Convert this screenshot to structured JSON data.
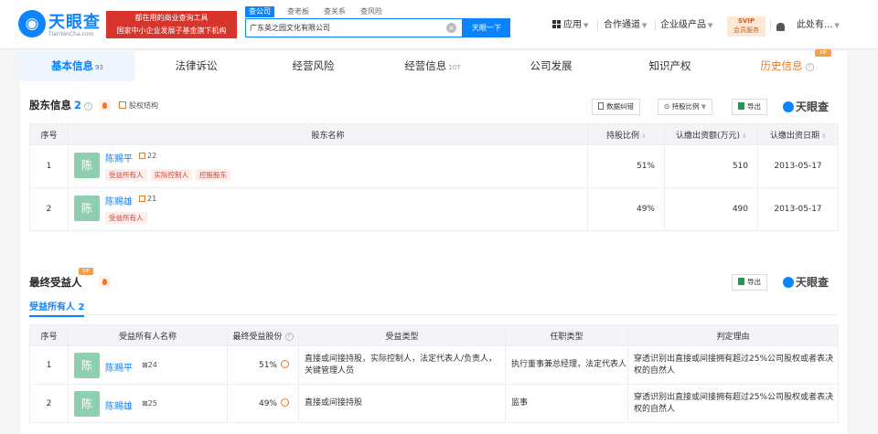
{
  "header": {
    "logo_name": "天眼查",
    "logo_sub": "TianYanCha.com",
    "banner_line1": "都在用的商业查询工具",
    "banner_line2": "国家中小企业发展子基金旗下机构",
    "search_tabs": [
      "查公司",
      "查老板",
      "查关系",
      "查风险"
    ],
    "search_value": "广东英之园文化有限公司",
    "search_button": "天眼一下",
    "nav": {
      "apps": "应用",
      "channel": "合作通道",
      "enterprise": "企业级产品",
      "user": "此处有..."
    },
    "vip": {
      "top": "SVIP",
      "bottom": "会员服务"
    }
  },
  "tabs": [
    {
      "label": "基本信息",
      "count": "93"
    },
    {
      "label": "法律诉讼",
      "count": ""
    },
    {
      "label": "经营风险",
      "count": ""
    },
    {
      "label": "经营信息",
      "count": "107"
    },
    {
      "label": "公司发展",
      "count": ""
    },
    {
      "label": "知识产权",
      "count": ""
    },
    {
      "label": "历史信息",
      "count": ""
    }
  ],
  "vip_tag": "VIP",
  "shareholders": {
    "title": "股东信息",
    "count": "2",
    "equity_link": "股权结构",
    "btn_correct": "数据纠错",
    "btn_ratio": "持股比例",
    "btn_export": "导出",
    "brand": "天眼查",
    "headers": [
      "序号",
      "股东名称",
      "持股比例",
      "认缴出资额(万元)",
      "认缴出资日期"
    ],
    "rows": [
      {
        "no": "1",
        "avatar": "陈",
        "name": "陈赐平",
        "num": "22",
        "tags": [
          "受益所有人",
          "实际控制人",
          "控股股东"
        ],
        "ratio": "51%",
        "amount": "510",
        "date": "2013-05-17"
      },
      {
        "no": "2",
        "avatar": "陈",
        "name": "陈赐雄",
        "num": "21",
        "tags": [
          "受益所有人"
        ],
        "ratio": "49%",
        "amount": "490",
        "date": "2013-05-17"
      }
    ]
  },
  "beneficiaries": {
    "title": "最终受益人",
    "btn_export": "导出",
    "brand": "天眼查",
    "subtab": "受益所有人",
    "subtab_count": "2",
    "headers": [
      "序号",
      "受益所有人名称",
      "最终受益股份",
      "受益类型",
      "任职类型",
      "判定理由"
    ],
    "rows": [
      {
        "no": "1",
        "avatar": "陈",
        "name": "陈赐平",
        "num": "24",
        "share": "51%",
        "type": "直接或间接持股，实际控制人，法定代表人/负责人，关键管理人员",
        "position": "执行董事兼总经理，法定代表人",
        "reason": "穿透识别出直接或间接拥有超过25%公司股权或者表决权的自然人"
      },
      {
        "no": "2",
        "avatar": "陈",
        "name": "陈赐雄",
        "num": "25",
        "share": "49%",
        "type": "直接或间接持股",
        "position": "监事",
        "reason": "穿透识别出直接或间接拥有超过25%公司股权或者表决权的自然人"
      }
    ]
  }
}
